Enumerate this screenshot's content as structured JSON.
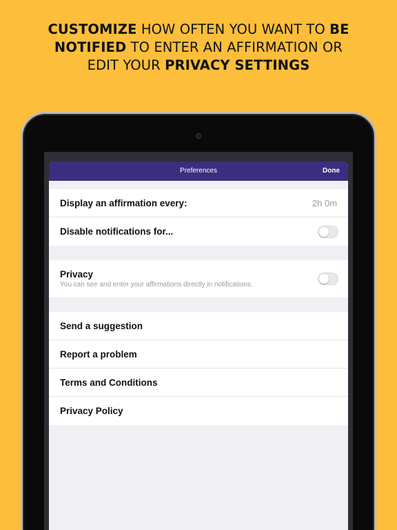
{
  "headline": {
    "line1_bold": "CUSTOMIZE",
    "line1_rest": " HOW OFTEN YOU WANT TO ",
    "line1_bold2": "BE",
    "line2_bold": "NOTIFIED",
    "line2_rest": " TO ENTER AN AFFIRMATION OR",
    "line3_rest": "EDIT YOUR ",
    "line3_bold": "PRIVACY SETTINGS"
  },
  "colors": {
    "background": "#FDBE3B",
    "navbar": "#3B2E80",
    "sheet": "#EFEFF4"
  },
  "navbar": {
    "title": "Preferences",
    "done_label": "Done"
  },
  "notifications": {
    "display_label": "Display an affirmation every:",
    "display_value": "2h 0m",
    "disable_label": "Disable notifications for...",
    "disable_on": false
  },
  "privacy": {
    "label": "Privacy",
    "description": "You can see and enter your affirmations directly in notifications.",
    "enabled": false
  },
  "links": [
    {
      "label": "Send a suggestion"
    },
    {
      "label": "Report a problem"
    },
    {
      "label": "Terms and Conditions"
    },
    {
      "label": "Privacy Policy"
    }
  ]
}
